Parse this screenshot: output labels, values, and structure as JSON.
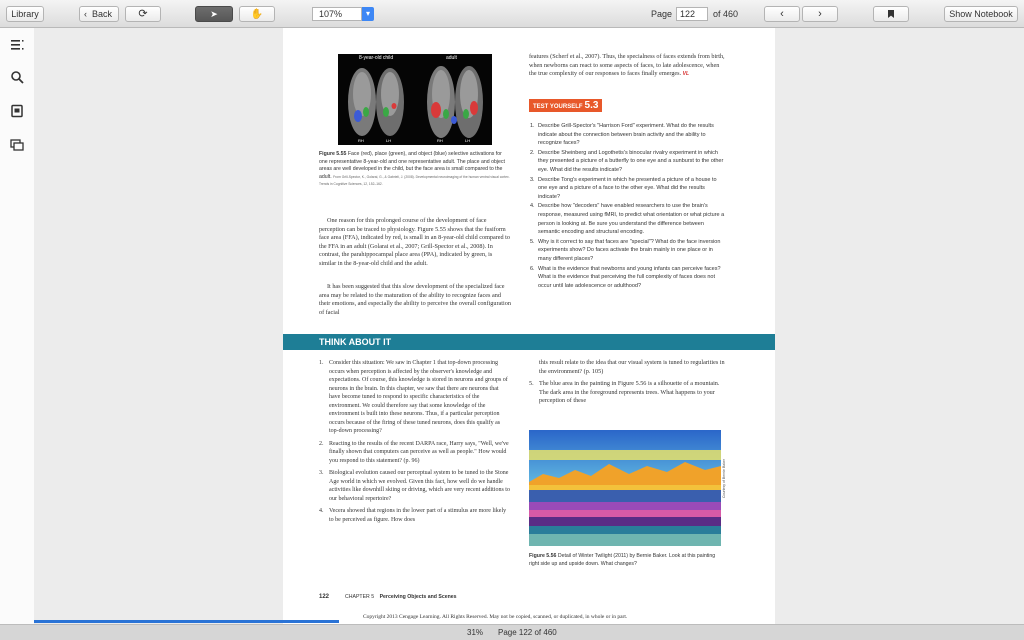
{
  "toolbar": {
    "library_label": "Library",
    "back_label": "Back",
    "zoom_value": "107%",
    "page_label": "Page",
    "page_value": "122",
    "page_total": "of 460",
    "show_notebook_label": "Show Notebook"
  },
  "sidebar": {
    "icons": [
      "toc-icon",
      "search-icon",
      "notes-icon",
      "cards-icon"
    ]
  },
  "page": {
    "figure555": {
      "label_left": "8-year-old child",
      "label_right": "adult",
      "rh": "RH",
      "lh": "LH",
      "caption_bold": "Figure 5.55",
      "caption": "Face (red), place (green), and object (blue) selective activations for one representative 8-year-old and one representative adult. The place and object areas are well developed in the child, but the face area is small compared to the adult.",
      "credit": "From Grill-Spector, K., Golarai, G., & Gabrieli, J. (2008). Developmental neuroimaging of the human ventral visual cortex. Trends in Cognitive Sciences, 12, 152–162."
    },
    "left_para1": "One reason for this prolonged course of the development of face perception can be traced to physiology. Figure 5.55 shows that the fusiform face area (FFA), indicated by red, is small in an 8-year-old child compared to the FFA in an adult (Golarai et al., 2007; Grill-Spector et al., 2008). In contrast, the parahippocampal place area (PPA), indicated by green, is similar in the 8-year-old child and the adult.",
    "left_para2": "It has been suggested that this slow development of the specialized face area may be related to the maturation of the ability to recognize faces and their emotions, and especially the ability to perceive the overall configuration of facial",
    "right_para": "features (Scherf et al., 2007). Thus, the specialness of faces extends from birth, when newborns can react to some aspects of faces, to late adolescence, when the true complexity of our responses to faces finally emerges.",
    "vl_badge": "VL",
    "test_yourself": "TEST YOURSELF",
    "test_number": "5.3",
    "questions": [
      "Describe Grill-Spector's \"Harrison Ford\" experiment. What do the results indicate about the connection between brain activity and the ability to recognize faces?",
      "Describe Sheinberg and Logothetis's binocular rivalry experiment in which they presented a picture of a butterfly to one eye and a sunburst to the other eye. What did the results indicate?",
      "Describe Tong's experiment in which he presented a picture of a house to one eye and a picture of a face to the other eye. What did the results indicate?",
      "Describe how \"decoders\" have enabled researchers to use the brain's response, measured using fMRI, to predict what orientation or what picture a person is looking at. Be sure you understand the difference between semantic encoding and structural encoding.",
      "Why is it correct to say that faces are \"special\"? What do the face inversion experiments show? Do faces activate the brain mainly in one place or in many different places?",
      "What is the evidence that newborns and young infants can perceive faces? What is the evidence that perceiving the full complexity of faces does not occur until late adolescence or adulthood?"
    ],
    "think_title": "THINK ABOUT IT",
    "think_left": [
      "Consider this situation: We saw in Chapter 1 that top-down processing occurs when perception is affected by the observer's knowledge and expectations. Of course, this knowledge is stored in neurons and groups of neurons in the brain. In this chapter, we saw that there are neurons that have become tuned to respond to specific characteristics of the environment. We could therefore say that some knowledge of the environment is built into these neurons. Thus, if a particular perception occurs because of the firing of these tuned neurons, does this qualify as top-down processing?",
      "Reacting to the results of the recent DARPA race, Harry says, \"Well, we've finally shown that computers can perceive as well as people.\" How would you respond to this statement? (p. 96)",
      "Biological evolution caused our perceptual system to be tuned to the Stone Age world in which we evolved. Given this fact, how well do we handle activities like downhill skiing or driving, which are very recent additions to our behavioral repertoire?",
      "Vecera showed that regions in the lower part of a stimulus are more likely to be perceived as figure. How does"
    ],
    "think_right_cont": "this result relate to the idea that our visual system is tuned to regularities in the environment? (p. 105)",
    "think_right_5": "The blue area in the painting in Figure 5.56 is a silhouette of a mountain. The dark area in the foreground represents trees. What happens to your perception of these",
    "figure556_bold": "Figure 5.56",
    "figure556_caption": "Detail of Winter Twilight (2011) by Bernie Baker. Look at this painting right side up and upside down. What changes?",
    "painting_credit": "Courtesy of Bernie Baker",
    "footer_page": "122",
    "footer_chapter": "CHAPTER 5",
    "footer_title": "Perceiving Objects and Scenes",
    "copyright": "Copyright 2013 Cengage Learning. All Rights Reserved. May not be copied, scanned, or duplicated, in whole or in part."
  },
  "status": {
    "progress_label": "31%",
    "progress_value": 0.31,
    "page_status": "Page 122 of 460"
  },
  "colors": {
    "toolbar_active": "#5d5d5d",
    "think_bar": "#1e7e96",
    "test_badge": "#e8582a",
    "progress": "#2a73d6"
  }
}
